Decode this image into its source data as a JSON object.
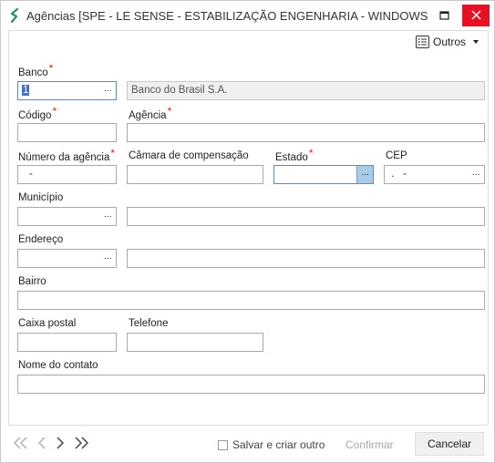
{
  "window": {
    "title": "Agências [SPE - LE SENSE - ESTABILIZAÇÃO ENGENHARIA - WINDOWS - J..."
  },
  "toolbar": {
    "outros_label": "Outros"
  },
  "form": {
    "banco": {
      "label": "Banco",
      "code_value": "1",
      "name_value": "Banco do Brasil S.A."
    },
    "codigo": {
      "label": "Código",
      "value": ""
    },
    "agencia": {
      "label": "Agência",
      "value": ""
    },
    "numero_agencia": {
      "label": "Número da agência",
      "value": " -"
    },
    "camara": {
      "label": "Câmara de compensação",
      "value": ""
    },
    "estado": {
      "label": "Estado",
      "value": ""
    },
    "cep": {
      "label": "CEP",
      "value": " .   -"
    },
    "municipio": {
      "label": "Município",
      "code_value": "",
      "name_value": ""
    },
    "endereco": {
      "label": "Endereço",
      "code_value": "",
      "name_value": ""
    },
    "bairro": {
      "label": "Bairro",
      "value": ""
    },
    "caixa_postal": {
      "label": "Caixa postal",
      "value": ""
    },
    "telefone": {
      "label": "Telefone",
      "value": ""
    },
    "nome_contato": {
      "label": "Nome do contato",
      "value": ""
    },
    "required_marker": "*",
    "lookup_glyph": "···"
  },
  "footer": {
    "save_and_create_label": "Salvar e criar outro",
    "confirm_label": "Confirmar",
    "cancel_label": "Cancelar"
  },
  "colors": {
    "required": "#e02020",
    "selection": "#3b73c9",
    "close_button": "#e81123",
    "active_lookup": "#a9cbe8",
    "brand_logo": "#2f8f6f"
  }
}
